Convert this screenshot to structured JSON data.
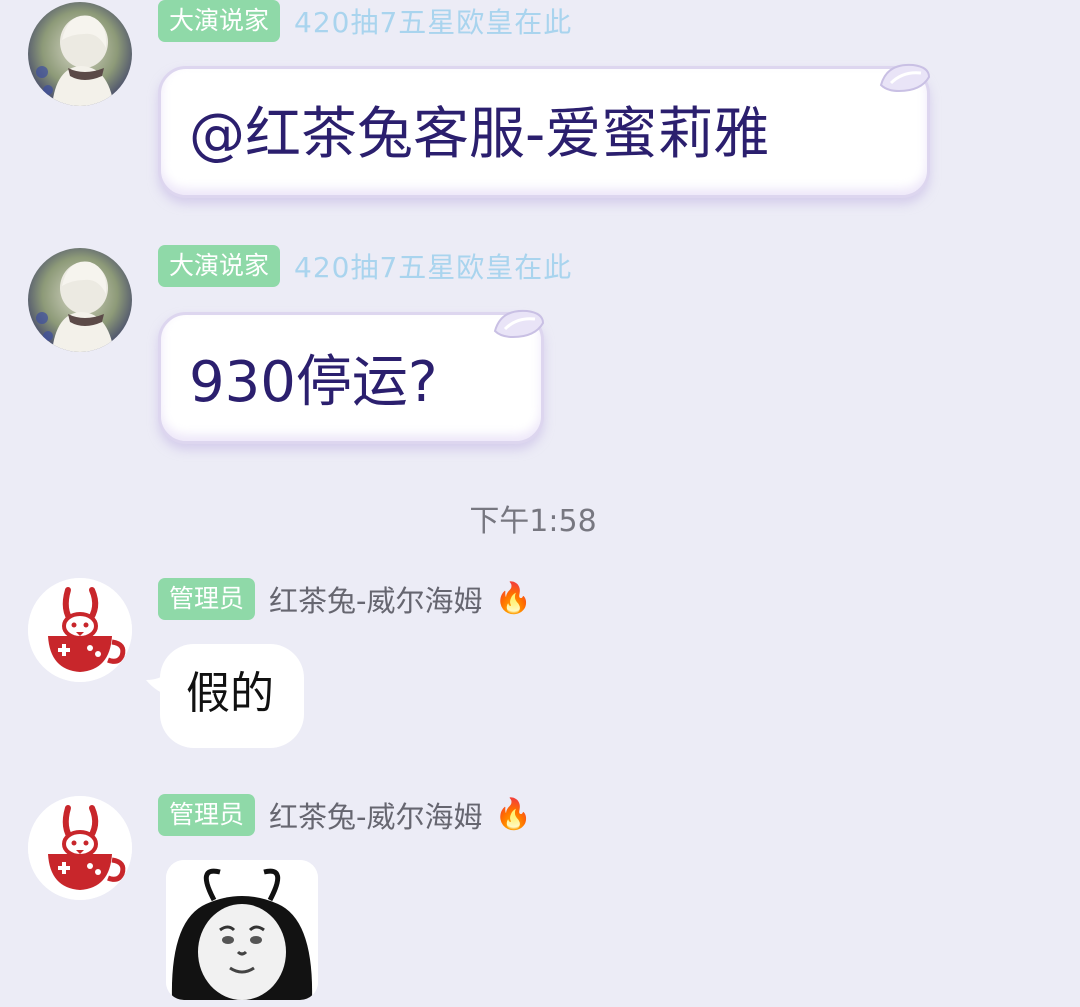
{
  "messages": [
    {
      "role": "大演说家",
      "title": "420抽7五星欧皇在此",
      "text": "@红茶兔客服-爱蜜莉雅"
    },
    {
      "role": "大演说家",
      "title": "420抽7五星欧皇在此",
      "text": "930停运?"
    },
    {
      "role": "管理员",
      "nickname": "红茶兔-威尔海姆",
      "badge_emoji": "🔥",
      "text": "假的"
    },
    {
      "role": "管理员",
      "nickname": "红茶兔-威尔海姆",
      "badge_emoji": "🔥",
      "sticker": "panda-face-meme-sticker"
    }
  ],
  "timestamp": "下午1:58",
  "icons": {
    "avatar_1": "white-haired-character-avatar",
    "avatar_2": "red-teacup-rabbit-avatar",
    "bubble_decoration": "petal-icon"
  },
  "colors": {
    "background": "#ececf6",
    "role_badge": "#8fd9a8",
    "title_text": "#a9d4ee",
    "fancy_text": "#2b1f6e",
    "nickname_text": "#666670",
    "teacup_red": "#c8262b"
  }
}
